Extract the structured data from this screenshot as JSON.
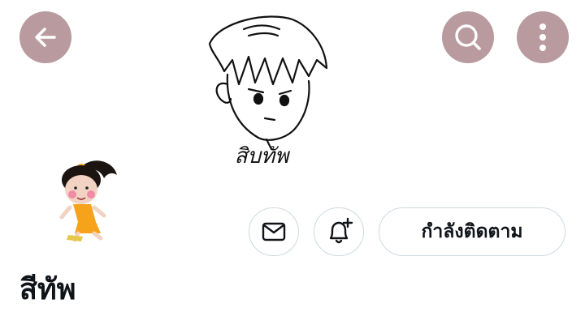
{
  "header": {
    "back_icon": "arrow-left-icon",
    "search_icon": "search-icon",
    "more_icon": "more-vertical-icon",
    "button_color": "#b89a9f"
  },
  "banner": {
    "caption": "สิบทัพ"
  },
  "profile": {
    "display_name": "สีทัพ",
    "following_label": "กำลังติดตาม",
    "message_icon": "envelope-icon",
    "notify_icon": "bell-plus-icon"
  }
}
